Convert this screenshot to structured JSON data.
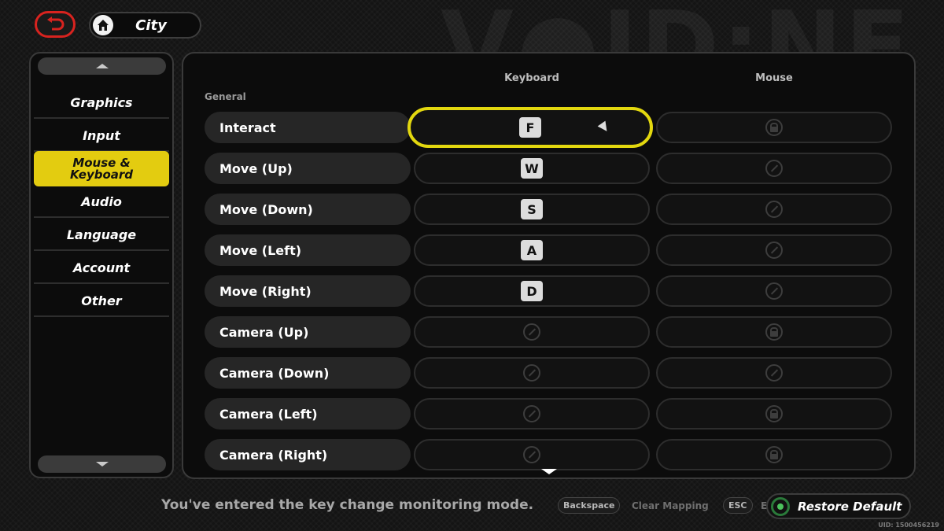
{
  "header": {
    "back_icon": "return-arrow-icon",
    "home_icon": "home-icon",
    "location": "City"
  },
  "sidebar": {
    "items": [
      {
        "label": "Graphics"
      },
      {
        "label": "Input"
      },
      {
        "label": "Mouse & Keyboard",
        "active": true
      },
      {
        "label": "Audio"
      },
      {
        "label": "Language"
      },
      {
        "label": "Account"
      },
      {
        "label": "Other"
      }
    ]
  },
  "bindings": {
    "columns": [
      "Keyboard",
      "Mouse"
    ],
    "section": "General",
    "rows": [
      {
        "action": "Interact",
        "keyboard": "F",
        "mouse": "locked",
        "selected": true
      },
      {
        "action": "Move (Up)",
        "keyboard": "W",
        "mouse": "unbound"
      },
      {
        "action": "Move (Down)",
        "keyboard": "S",
        "mouse": "unbound"
      },
      {
        "action": "Move (Left)",
        "keyboard": "A",
        "mouse": "unbound"
      },
      {
        "action": "Move (Right)",
        "keyboard": "D",
        "mouse": "unbound"
      },
      {
        "action": "Camera (Up)",
        "keyboard": "unbound",
        "mouse": "locked"
      },
      {
        "action": "Camera (Down)",
        "keyboard": "unbound",
        "mouse": "unbound"
      },
      {
        "action": "Camera (Left)",
        "keyboard": "unbound",
        "mouse": "locked"
      },
      {
        "action": "Camera (Right)",
        "keyboard": "unbound",
        "mouse": "locked"
      }
    ]
  },
  "footer": {
    "message": "You've entered the key change monitoring mode.",
    "hint_backspace_key": "Backspace",
    "hint_backspace_text": "Clear Mapping",
    "hint_esc_key": "ESC",
    "hint_esc_text": "Exit",
    "restore_label": "Restore Default",
    "uid": "UID: 1500456219"
  },
  "colors": {
    "accent_yellow": "#e3cc10",
    "back_red": "#d8231f",
    "restore_green": "#4cc35d"
  }
}
